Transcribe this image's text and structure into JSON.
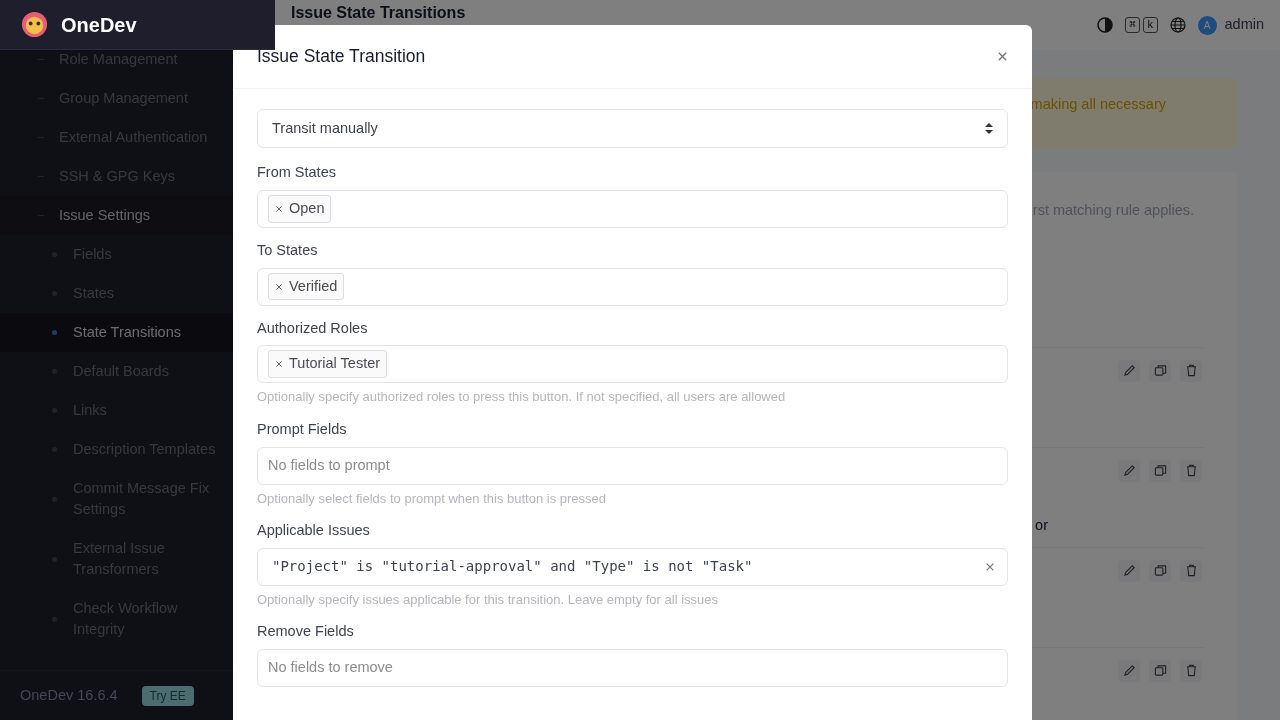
{
  "app": {
    "name": "OneDev",
    "version": "OneDev 16.6.4",
    "try_ee": "Try EE"
  },
  "sidebar": {
    "items": [
      {
        "label": "Role Management",
        "selected": false
      },
      {
        "label": "Group Management",
        "selected": false
      },
      {
        "label": "External Authentication",
        "selected": false
      },
      {
        "label": "SSH & GPG Keys",
        "selected": false
      },
      {
        "label": "Issue Settings",
        "selected": true,
        "children": [
          {
            "label": "Fields",
            "selected": false
          },
          {
            "label": "States",
            "selected": false
          },
          {
            "label": "State Transitions",
            "selected": true
          },
          {
            "label": "Default Boards",
            "selected": false
          },
          {
            "label": "Links",
            "selected": false
          },
          {
            "label": "Description Templates",
            "selected": false
          },
          {
            "label": "Commit Message Fix Settings",
            "selected": false
          },
          {
            "label": "External Issue Transformers",
            "selected": false
          },
          {
            "label": "Check Workflow Integrity",
            "selected": false
          }
        ]
      }
    ]
  },
  "header": {
    "page_title": "Issue State Transitions",
    "shortcut_keys": [
      "⌘",
      "k"
    ],
    "user_initial": "A",
    "user_name": "admin"
  },
  "background": {
    "banner": "making all necessary",
    "card_note": "rst matching rule applies.",
    "rules": [
      {
        "kind": "plain"
      },
      {
        "kind": "note",
        "text": "or"
      },
      {
        "kind": "plain"
      },
      {
        "kind": "plain"
      }
    ]
  },
  "dialog": {
    "title": "Issue State Transition",
    "trigger": "Transit manually",
    "fields": [
      {
        "kind": "tags",
        "label": "From States",
        "tags": [
          "Open"
        ]
      },
      {
        "kind": "tags",
        "label": "To States",
        "tags": [
          "Verified"
        ]
      },
      {
        "kind": "tags",
        "label": "Authorized Roles",
        "tags": [
          "Tutorial Tester"
        ],
        "help": "Optionally specify authorized roles to press this button. If not specified, all users are allowed"
      },
      {
        "kind": "choice",
        "label": "Prompt Fields",
        "placeholder": "No fields to prompt",
        "help": "Optionally select fields to prompt when this button is pressed"
      },
      {
        "kind": "query",
        "label": "Applicable Issues",
        "value": "\"Project\" is \"tutorial-approval\" and \"Type\" is not \"Task\"",
        "help": "Optionally specify issues applicable for this transition. Leave empty for all issues"
      },
      {
        "kind": "choice",
        "label": "Remove Fields",
        "placeholder": "No fields to remove"
      }
    ]
  }
}
